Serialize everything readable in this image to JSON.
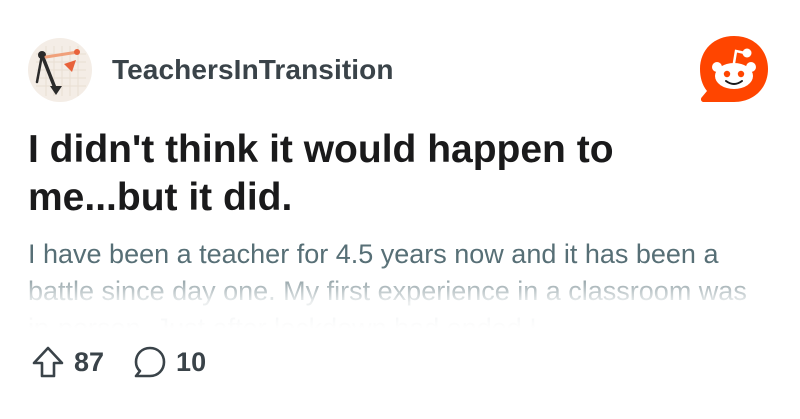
{
  "post": {
    "subreddit": "TeachersInTransition",
    "title": "I didn't think it would happen to me...but it did.",
    "body": "I have been a teacher for 4.5 years now and it has been a battle since day one. My first experience in a classroom was in-person. Just after lockdown had ended I"
  },
  "stats": {
    "upvotes": "87",
    "comments": "10"
  },
  "icons": {
    "avatar": "pencil-compass-icon",
    "brand": "reddit-snoo-icon",
    "upvote": "upvote-arrow-icon",
    "comment": "comment-bubble-icon"
  },
  "colors": {
    "brand": "#ff4500",
    "title": "#1a1a1b",
    "body": "#576f76",
    "meta": "#3a4349"
  }
}
